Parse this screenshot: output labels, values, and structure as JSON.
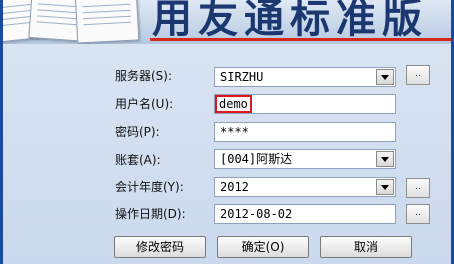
{
  "banner": {
    "title_fragment": "用友通标准版"
  },
  "fields": {
    "server": {
      "label": "服务器(S):",
      "value": "SIRZHU"
    },
    "username": {
      "label": "用户名(U):",
      "value": "demo"
    },
    "password": {
      "label": "密码(P):",
      "value": "****"
    },
    "account": {
      "label": "账套(A):",
      "value": "[004]阿斯达"
    },
    "fiscal_year": {
      "label": "会计年度(Y):",
      "value": "2012"
    },
    "operation_date": {
      "label": "操作日期(D):",
      "value": "2012-08-02"
    }
  },
  "buttons": {
    "browse": "..",
    "change_password": "修改密码",
    "ok": "确定(O)",
    "cancel": "取消"
  },
  "colors": {
    "highlight": "#e0161b",
    "accent": "#d42a1a",
    "frame": "#1a4aa0"
  }
}
